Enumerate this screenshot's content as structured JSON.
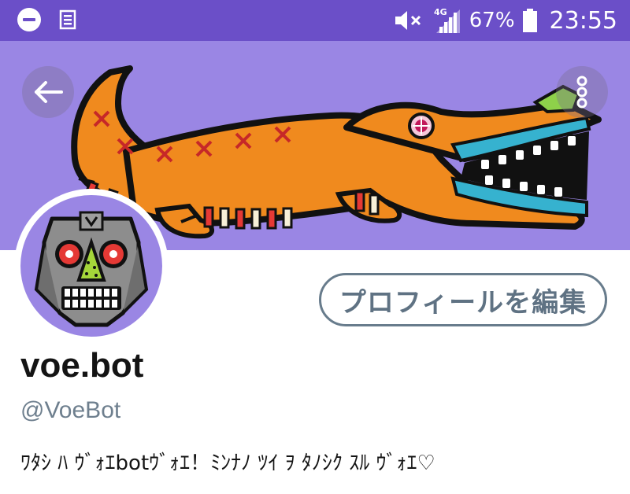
{
  "status_bar": {
    "network": "4G",
    "battery_percent": "67%",
    "time": "23:55",
    "bg_color": "#6b4fc8"
  },
  "header": {
    "back_icon": "arrow-left-icon",
    "more_icon": "more-vertical-icon",
    "banner_color": "#9a86e4"
  },
  "profile": {
    "edit_button_label": "プロフィールを編集",
    "display_name": "voe.bot",
    "handle": "@VoeBot",
    "bio": "ﾜﾀｼ ﾊ ｳﾞｫｴbotｳﾞｫｴ！ﾐﾝﾅﾉ ﾂｲ ｦ ﾀﾉｼｸ ｽﾙ ｳﾞｫｴ♡"
  }
}
